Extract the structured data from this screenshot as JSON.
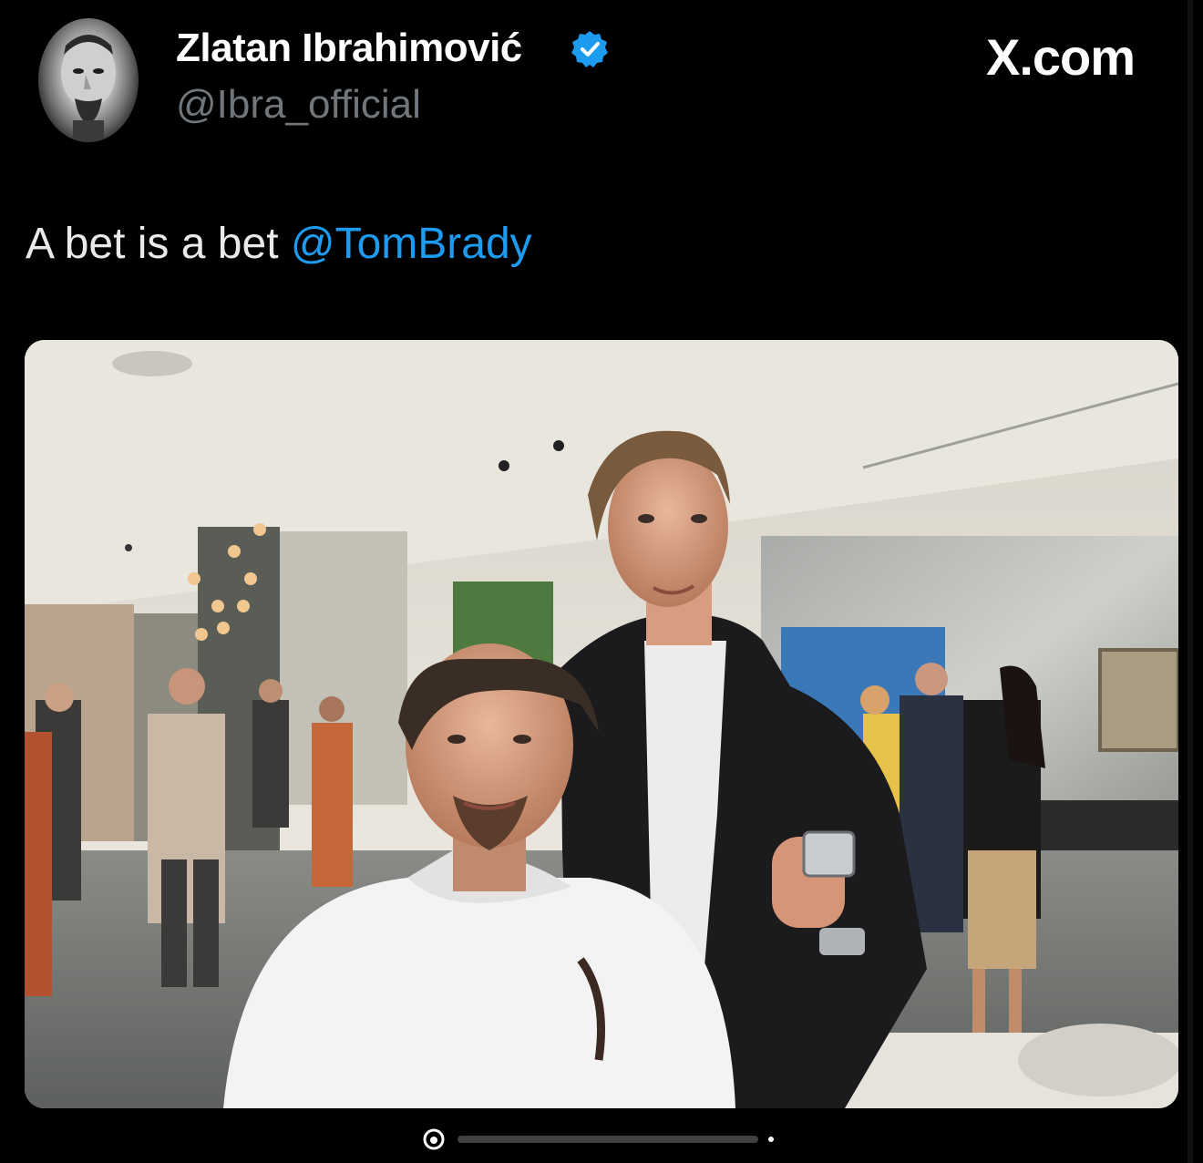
{
  "author": {
    "display_name": "Zlatan Ibrahimović",
    "handle": "@Ibra_official",
    "verified": true
  },
  "site_logo": "X.com",
  "tweet": {
    "text": "A bet is a bet ",
    "mention": "@TomBrady"
  },
  "colors": {
    "background": "#000000",
    "text": "#e7e9ea",
    "secondary_text": "#71767b",
    "accent": "#1d9bf0"
  },
  "icons": {
    "verified": "verified-badge-icon",
    "watermark": "watermark-icon"
  }
}
